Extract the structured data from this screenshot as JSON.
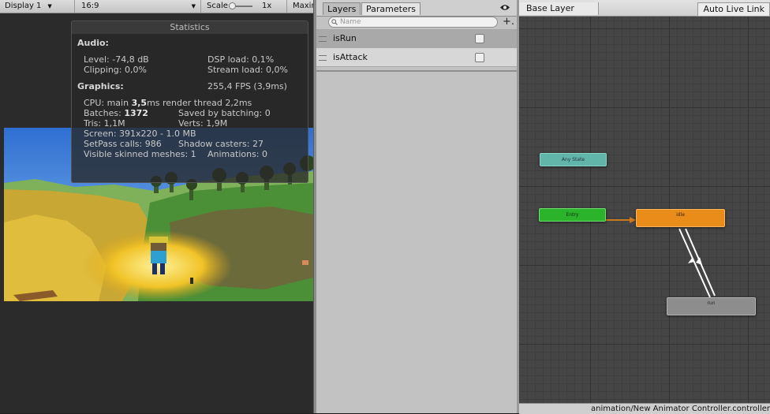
{
  "game_toolbar": {
    "display": "Display 1",
    "aspect": "16:9",
    "scale_label": "Scale",
    "scale_value": "1x",
    "maximize": "Maxin"
  },
  "statistics": {
    "title": "Statistics",
    "audio_header": "Audio:",
    "level": "Level: -74,8 dB",
    "dsp_load": "DSP load: 0,1%",
    "clipping": "Clipping: 0,0%",
    "stream_load": "Stream load: 0,0%",
    "graphics_header": "Graphics:",
    "fps": "255,4 FPS (3,9ms)",
    "cpu_prefix": "CPU: main ",
    "cpu_main": "3,5",
    "cpu_suffix": "ms  render thread 2,2ms",
    "batches_prefix": "Batches: ",
    "batches": "1372",
    "saved_by_batching": "Saved by batching: 0",
    "tris": "Tris: 1,1M",
    "verts": "Verts: 1,9M",
    "screen": "Screen: 391x220 - 1.0 MB",
    "setpass": "SetPass calls: 986",
    "shadow_casters": "Shadow casters: 27",
    "skinned_meshes": "Visible skinned meshes: 1",
    "animations": "Animations: 0"
  },
  "animator": {
    "tabs": [
      "Layers",
      "Parameters"
    ],
    "active_tab": "Parameters",
    "search_placeholder": "Name",
    "add_label": "+.",
    "parameters": [
      {
        "name": "isRun",
        "type": "bool",
        "value": false
      },
      {
        "name": "isAttack",
        "type": "bool",
        "value": false
      }
    ],
    "breadcrumb": "Base Layer",
    "live_link": "Auto Live Link",
    "states": {
      "any_state": "Any State",
      "entry": "Entry",
      "idle": "idle",
      "run": "run"
    },
    "status_path": "animation/New Animator Controller.controller"
  },
  "colors": {
    "any_state": "#62b6a9",
    "entry": "#2bb32b",
    "default_state": "#e98c19",
    "state": "#8d8d8d",
    "transition_default": "#c9781a",
    "transition": "#ffffff"
  }
}
